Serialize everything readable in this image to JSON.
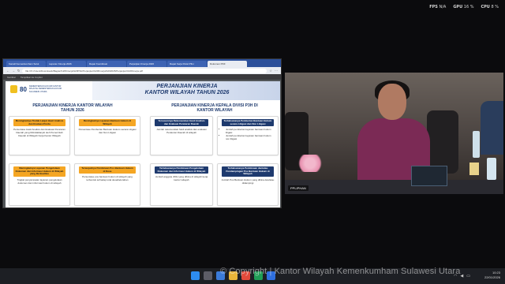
{
  "overlay": {
    "fps_label": "FPS",
    "fps_value": "N/A",
    "gpu_label": "GPU",
    "gpu_value": "16 %",
    "cpu_label": "CPU",
    "cpu_value": "8 %"
  },
  "browser": {
    "tabs": [
      "Kanwil Kemenkumham Sulut",
      "Laporan Kinerja 2026",
      "Rapat Koordinasi",
      "Perjanjian Kinerja 2026",
      "Rapat Kerja Divisi P3H",
      "Dokumen PDF"
    ],
    "url": "file:///C:/Users/Downloads/Bagian%20Kinerja%20P3H/Perjanjian%20Kinerja%202026/Perjanjian%20Kinerja.pdf",
    "pdf_toolbar": [
      "Gambar",
      "Tampilkan ke Copilot"
    ]
  },
  "document": {
    "org": "KEMENTERIAN HUKUM KANTOR WILAYAH KEMENTERIAN HUKUM SULAWESI UTARA",
    "anniversary": "80",
    "title_line1": "PERJANJIAN KINERJA",
    "title_line2": "KANTOR WILAYAH TAHUN 2026",
    "left_heading_1": "PERJANJIAN KINERJA KANTOR WILAYAH",
    "left_heading_2": "TAHUN 2026",
    "right_heading_1": "PERJANJIAN KINERJA KEPALA DIVISI P3H DI",
    "right_heading_2": "KANTOR WILAYAH",
    "left_cards": [
      {
        "title": "Meningkatnya Tindak Lanjut Hasil Analisis dan Evaluasi Perda",
        "body": "Persentase Hasil Analisis dan Evaluasi Peraturan Daerah yang Ditindaklanjuti oleh Pemerintah Daerah di Wilayah Kerja Kantor Wilayah"
      },
      {
        "title": "Meningkatnya Layanan Bantuan Hukum di Wilayah",
        "body": "Persentase Pemberian Bantuan Hukum secara Litigasi dan Non Litigasi"
      },
      {
        "title": "Meningkatnya Layanan Pengelolaan Dokumen dan Informasi Hukum di Wilayah yang Berkualitas",
        "body": "Tingkat penyampaian layanan pengelolaan dokumen dan informasi hukum di wilayah"
      },
      {
        "title": "Terwujudnya Pembinaan Pos Bantuan Hukum di Desa",
        "body": "Persentase pos bantuan hukum di wilayah yang terbentuk terhadap total desa/kelurahan"
      }
    ],
    "right_cards": [
      {
        "title": "Tersusunnya Rekomendasi Hasil Analisis dan Evaluasi Peraturan Daerah",
        "body": "Jumlah rekomendasi hasil analisis dan evaluasi Peraturan Daerah di wilayah"
      },
      {
        "title": "Terlaksananya Pemberian Bantuan Hukum secara Litigasi dan Non Litigasi",
        "bullets": [
          "Jumlah pemberian layanan bantuan hukum litigasi",
          "Jumlah pemberian layanan bantuan hukum non litigasi"
        ]
      },
      {
        "title": "Terlaksananya Pembinaan Pengelolaan Dokumen dan Informasi Hukum di Wilayah",
        "body": "Jumlah anggota JDIH yang dibina di wilayah kerja kantor wilayah"
      },
      {
        "title": "Terlaksananya Pembinaan dan/atau Pendampingan Pos Bantuan Hukum di Wilayah",
        "body": "Jumlah Pos Bantuan Hukum yang dibina dan/atau didampingi"
      }
    ]
  },
  "video": {
    "participant_label": "PPLIPHAN"
  },
  "taskbar": {
    "time": "10:23",
    "date": "22/01/2026"
  },
  "watermark": "© Copyright | Kantor Wilayah Kemenkumham Sulawesi Utara",
  "colors": {
    "accent_orange": "#f5a623",
    "navy": "#1e3a6e",
    "taskbar_bg": "#1d1f24"
  }
}
